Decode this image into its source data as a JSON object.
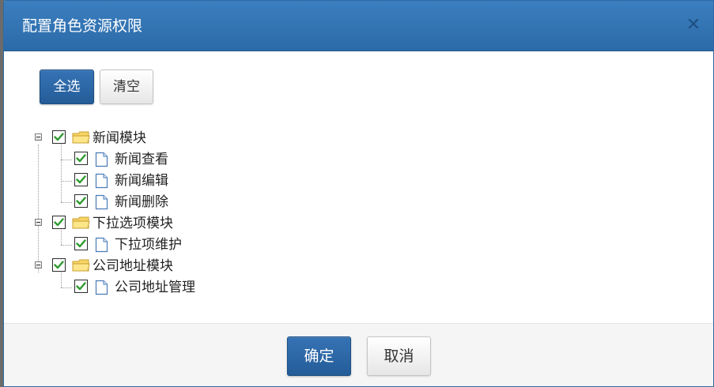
{
  "dialog": {
    "title": "配置角色资源权限",
    "close_glyph": "✕"
  },
  "toolbar": {
    "select_all_label": "全选",
    "clear_label": "清空"
  },
  "tree": [
    {
      "label": "新闻模块",
      "checked": true,
      "children": [
        {
          "label": "新闻查看",
          "checked": true
        },
        {
          "label": "新闻编辑",
          "checked": true
        },
        {
          "label": "新闻删除",
          "checked": true
        }
      ]
    },
    {
      "label": "下拉选项模块",
      "checked": true,
      "children": [
        {
          "label": "下拉项维护",
          "checked": true
        }
      ]
    },
    {
      "label": "公司地址模块",
      "checked": true,
      "children": [
        {
          "label": "公司地址管理",
          "checked": true
        }
      ]
    }
  ],
  "footer": {
    "confirm_label": "确定",
    "cancel_label": "取消"
  },
  "colors": {
    "header": "#2f70b0",
    "primary_button": "#2a63a0",
    "check": "#2e9a2e",
    "folder": "#f7d565"
  }
}
